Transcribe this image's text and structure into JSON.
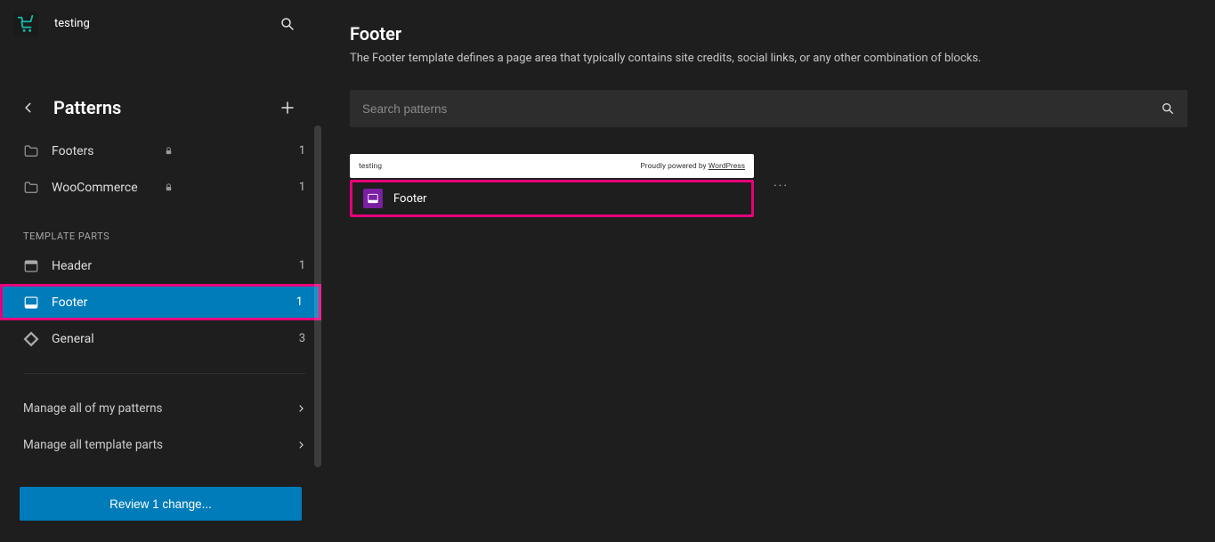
{
  "site": {
    "title": "testing"
  },
  "sidebar": {
    "heading": "Patterns",
    "categories": [
      {
        "label": "Footers",
        "locked": true,
        "count": "1"
      },
      {
        "label": "WooCommerce",
        "locked": true,
        "count": "1"
      }
    ],
    "section_label": "TEMPLATE PARTS",
    "template_parts": [
      {
        "label": "Header",
        "count": "1",
        "active": false,
        "kind": "header"
      },
      {
        "label": "Footer",
        "count": "1",
        "active": true,
        "kind": "footer"
      },
      {
        "label": "General",
        "count": "3",
        "active": false,
        "kind": "general"
      }
    ],
    "manage_patterns_label": "Manage all of my patterns",
    "manage_tparts_label": "Manage all template parts",
    "review_button": "Review 1 change..."
  },
  "main": {
    "title": "Footer",
    "description": "The Footer template defines a page area that typically contains site credits, social links, or any other combination of blocks.",
    "search_placeholder": "Search patterns",
    "card": {
      "preview_site": "testing",
      "preview_powered_prefix": "Proudly powered by ",
      "preview_powered_link": "WordPress",
      "label": "Footer"
    }
  }
}
